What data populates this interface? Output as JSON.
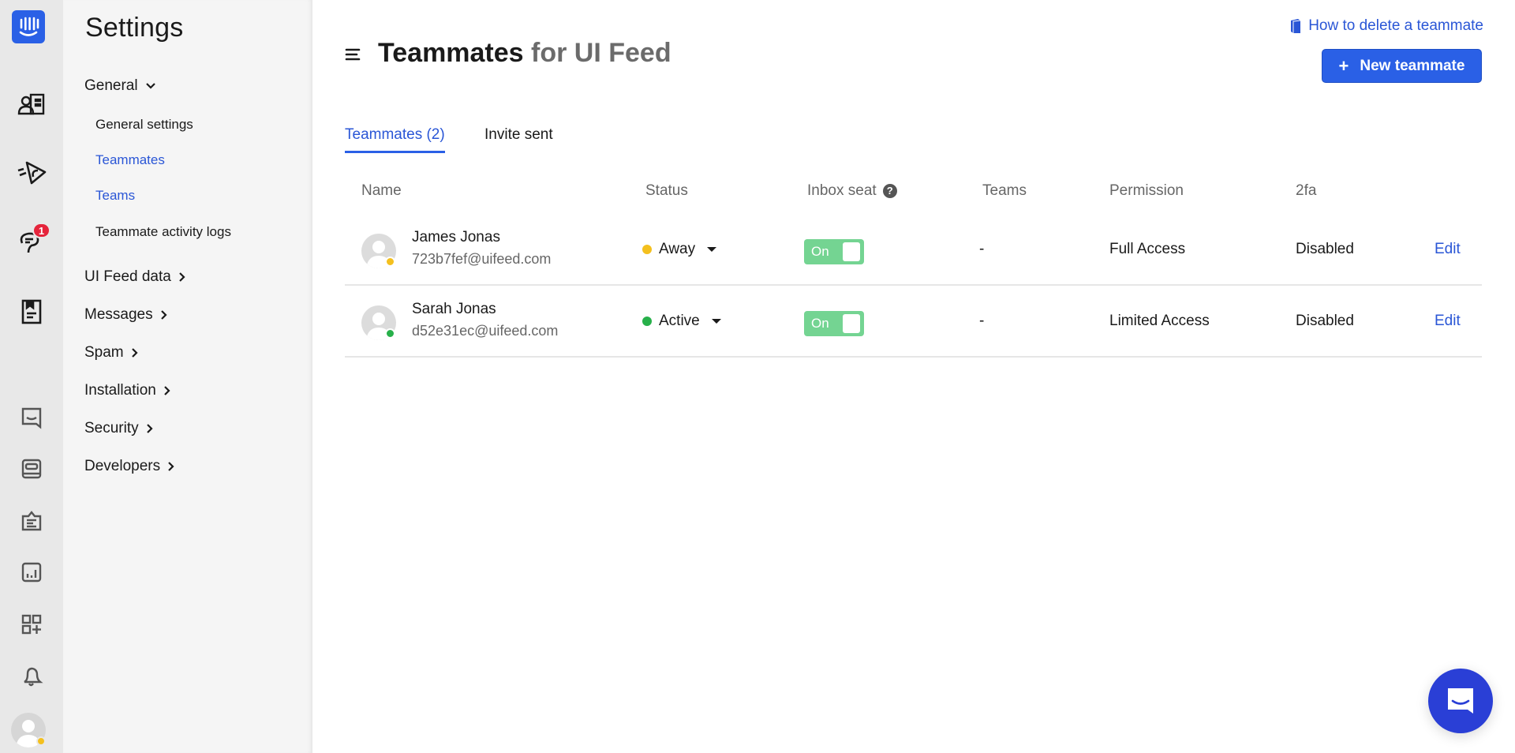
{
  "rail": {
    "badge_count": "1",
    "items": [
      {
        "name": "contacts-icon"
      },
      {
        "name": "outbound-icon"
      },
      {
        "name": "inbox-icon"
      },
      {
        "name": "articles-icon"
      },
      {
        "name": "messenger-icon"
      },
      {
        "name": "help-center-icon"
      },
      {
        "name": "operator-icon"
      },
      {
        "name": "reports-icon"
      },
      {
        "name": "app-store-icon"
      },
      {
        "name": "notifications-icon"
      }
    ],
    "colors": {
      "brand": "#2a60e6",
      "badge": "#e5243b",
      "away": "#f4c01e"
    }
  },
  "settings": {
    "title": "Settings",
    "sections": [
      {
        "label": "General",
        "expanded": true
      },
      {
        "label": "UI Feed data"
      },
      {
        "label": "Messages"
      },
      {
        "label": "Spam"
      },
      {
        "label": "Installation"
      },
      {
        "label": "Security"
      },
      {
        "label": "Developers"
      }
    ],
    "general_items": [
      {
        "label": "General settings"
      },
      {
        "label": "Teammates",
        "active": true
      },
      {
        "label": "Teams"
      },
      {
        "label": "Teammate activity logs"
      }
    ],
    "chevron_down": "⌄",
    "chevron_right": "›"
  },
  "header": {
    "title": "Teammates",
    "title_suffix": " for UI Feed",
    "help_link": "How to delete a teammate",
    "new_button": "New teammate",
    "new_button_plus": "+"
  },
  "tabs": [
    {
      "label": "Teammates (2)",
      "active": true
    },
    {
      "label": "Invite sent",
      "active": false
    }
  ],
  "table": {
    "columns": [
      "Name",
      "Status",
      "Inbox seat",
      "Teams",
      "Permission",
      "2fa"
    ],
    "help_glyph": "?",
    "rows": [
      {
        "name": "James Jonas",
        "email": "723b7fef@uifeed.com",
        "status": "Away",
        "status_color": "#f4c01e",
        "inbox_seat": "On",
        "teams": "-",
        "permission": "Full Access",
        "twofa": "Disabled",
        "action": "Edit"
      },
      {
        "name": "Sarah Jonas",
        "email": "d52e31ec@uifeed.com",
        "status": "Active",
        "status_color": "#27b04a",
        "inbox_seat": "On",
        "teams": "-",
        "permission": "Limited Access",
        "twofa": "Disabled",
        "action": "Edit"
      }
    ]
  }
}
